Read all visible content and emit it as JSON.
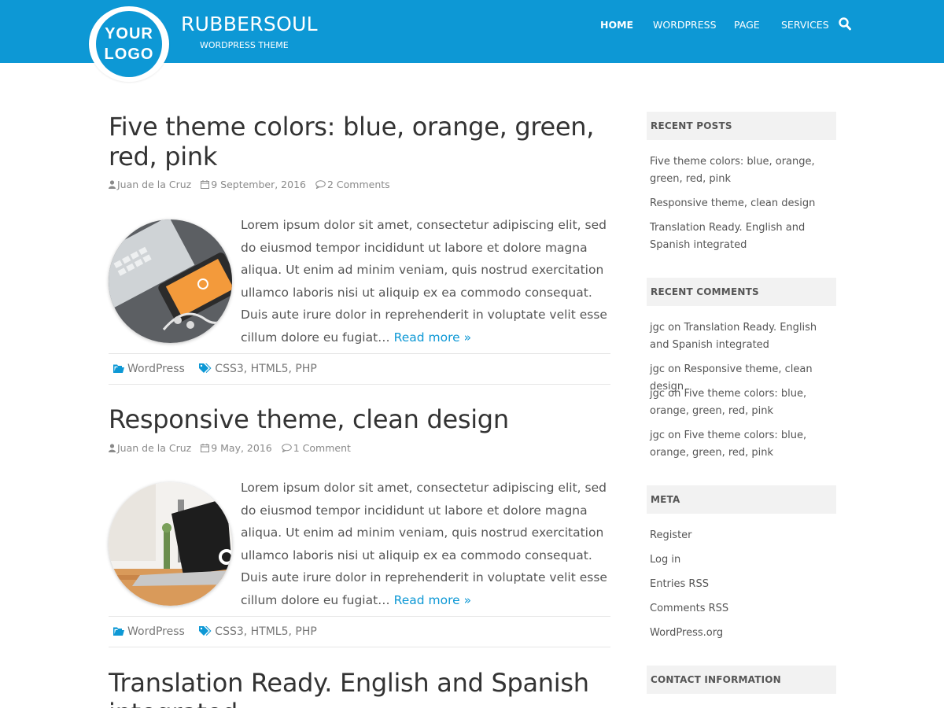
{
  "logo": {
    "line1": "YOUR",
    "line2": "LOGO"
  },
  "site": {
    "title": "RUBBERSOUL",
    "description": "WORDPRESS THEME"
  },
  "nav": {
    "items": [
      "HOME",
      "WORDPRESS",
      "PAGE",
      "SERVICES"
    ],
    "active": "HOME"
  },
  "posts": [
    {
      "title": "Five theme colors: blue, orange, green, red, pink",
      "author": "Juan de la Cruz",
      "date": "9 September, 2016",
      "comments": "2 Comments",
      "excerpt": "Lorem ipsum dolor sit amet, consectetur adipiscing elit, sed do eiusmod tempor incididunt ut labore et dolore magna aliqua. Ut enim ad minim veniam, quis nostrud exercitation ullamco laboris nisi ut aliquip ex ea commodo consequat. Duis aute irure dolor in reprehenderit in voluptate velit esse cillum dolore eu fugiat…",
      "read_more": "Read more »",
      "category": "WordPress",
      "tags": "CSS3, HTML5, PHP"
    },
    {
      "title": "Responsive theme, clean design",
      "author": "Juan de la Cruz",
      "date": "9 May, 2016",
      "comments": "1 Comment",
      "excerpt": "Lorem ipsum dolor sit amet, consectetur adipiscing elit, sed do eiusmod tempor incididunt ut labore et dolore magna aliqua. Ut enim ad minim veniam, quis nostrud exercitation ullamco laboris nisi ut aliquip ex ea commodo consequat. Duis aute irure dolor in reprehenderit in voluptate velit esse cillum dolore eu fugiat…",
      "read_more": "Read more »",
      "category": "WordPress",
      "tags": "CSS3, HTML5, PHP"
    },
    {
      "title": "Translation Ready. English and Spanish integrated"
    }
  ],
  "sidebar": {
    "recent_posts": {
      "heading": "RECENT POSTS",
      "items": [
        "Five theme colors: blue, orange, green, red, pink",
        "Responsive theme, clean design",
        "Translation Ready. English and Spanish integrated"
      ]
    },
    "recent_comments": {
      "heading": "RECENT COMMENTS",
      "items": [
        "jgc on Translation Ready. English and Spanish integrated",
        "jgc on Responsive theme, clean design",
        "jgc on Five theme colors: blue, orange, green, red, pink",
        "jgc on Five theme colors: blue, orange, green, red, pink"
      ]
    },
    "meta": {
      "heading": "META",
      "items": [
        "Register",
        "Log in",
        "Entries RSS",
        "Comments RSS",
        "WordPress.org"
      ]
    },
    "contact": {
      "heading": "CONTACT INFORMATION"
    }
  },
  "icons": {
    "author": "user-icon",
    "date": "calendar-icon",
    "comments": "comment-icon",
    "category": "folder-icon",
    "tags": "tags-icon",
    "search": "search-icon"
  },
  "colors": {
    "primary": "#0d98d5",
    "widget_bg": "#f2f2f2",
    "text": "#444444"
  }
}
